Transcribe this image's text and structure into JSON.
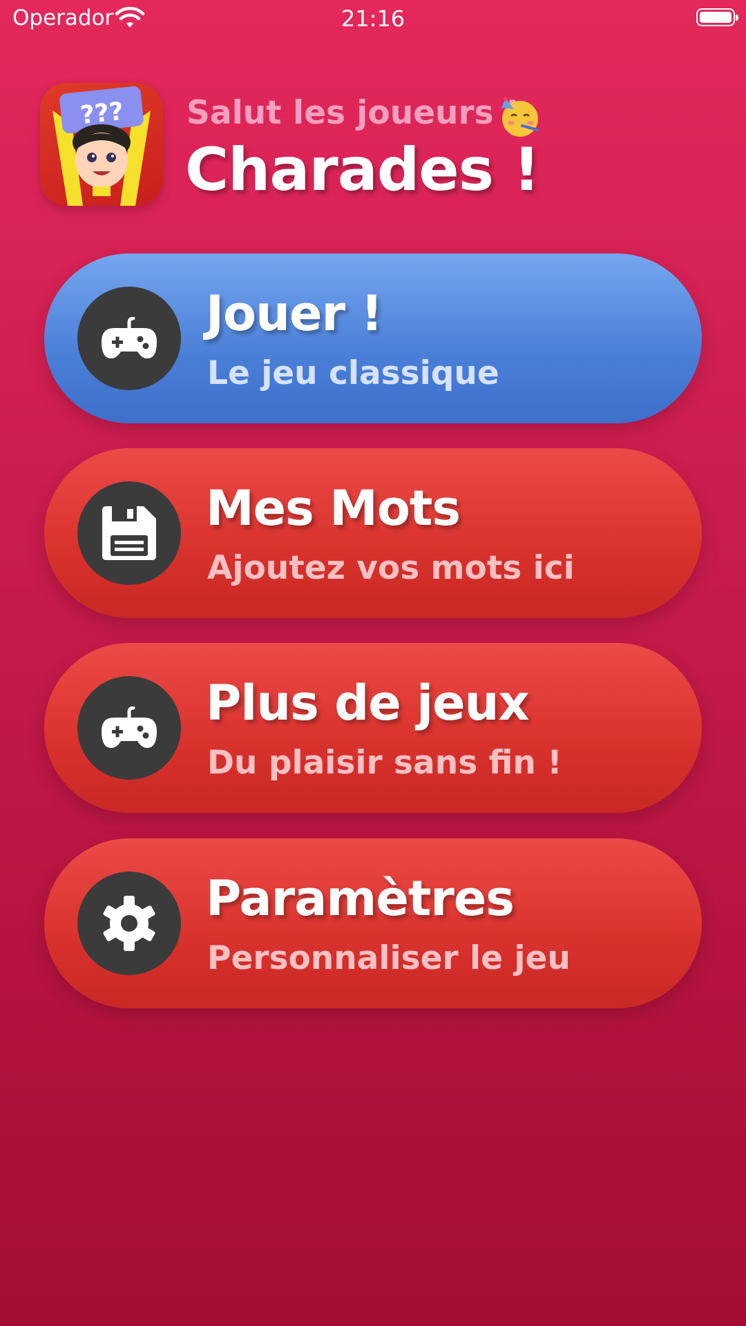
{
  "status_bar": {
    "carrier": "Operador",
    "time": "21:16",
    "wifi_icon": "wifi-icon",
    "battery_icon": "battery-icon"
  },
  "header": {
    "app_icon": "charades-app-icon",
    "greeting": "Salut les joueurs !",
    "greeting_emoji": "partying-face-emoji",
    "title": "Charades !"
  },
  "menu": [
    {
      "title": "Jouer !",
      "subtitle": "Le jeu classique",
      "icon": "gamepad-icon",
      "color": "#4a7fd8"
    },
    {
      "title": "Mes Mots",
      "subtitle": "Ajoutez vos mots ici",
      "icon": "save-icon",
      "color": "#d8322d"
    },
    {
      "title": "Plus de jeux",
      "subtitle": "Du plaisir sans fin !",
      "icon": "gamepad-icon",
      "color": "#d8322d"
    },
    {
      "title": "Paramètres",
      "subtitle": "Personnaliser le jeu",
      "icon": "gear-icon",
      "color": "#d8322d"
    }
  ]
}
